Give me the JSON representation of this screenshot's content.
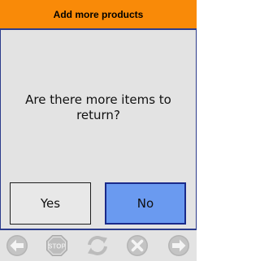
{
  "header": {
    "title": "Add more products",
    "color": "#f98a08"
  },
  "dialog": {
    "question": "Are there more items to return?",
    "yes_label": "Yes",
    "no_label": "No",
    "no_color": "#6a9af0"
  },
  "toolbar": {
    "back_icon": "arrow-left-icon",
    "stop_label": "STOP",
    "stop_icon": "stop-sign-icon",
    "refresh_icon": "refresh-icon",
    "cancel_icon": "close-circle-icon",
    "forward_icon": "arrow-right-icon"
  }
}
